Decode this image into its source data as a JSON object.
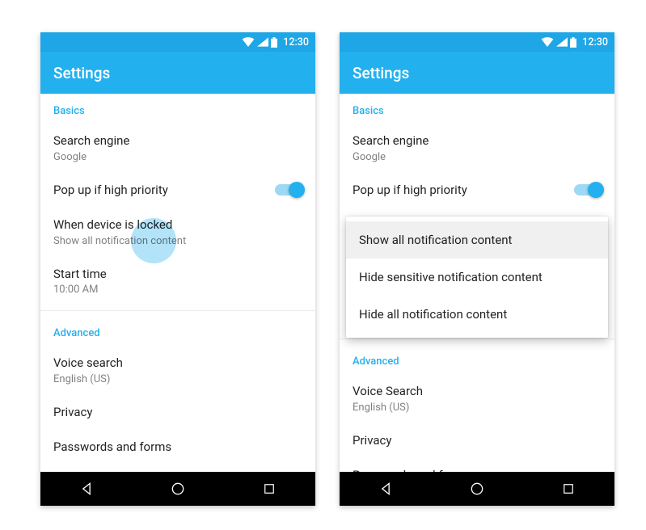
{
  "status": {
    "time": "12:30"
  },
  "appbar": {
    "title": "Settings"
  },
  "sections": {
    "basics": {
      "header": "Basics",
      "searchEngine": {
        "title": "Search engine",
        "value": "Google"
      },
      "popup": {
        "title": "Pop up if high priority"
      },
      "locked": {
        "title": "When device is locked",
        "value": "Show all notification content"
      },
      "startTime": {
        "title": "Start time",
        "value": "10:00 AM"
      }
    },
    "advanced": {
      "header": "Advanced",
      "voiceSearch": {
        "titleA": "Voice search",
        "titleB": "Voice Search",
        "value": "English (US)"
      },
      "privacy": {
        "title": "Privacy"
      },
      "passwordsForms": {
        "title": "Passwords and forms"
      }
    }
  },
  "dropdown": {
    "options": [
      "Show all notification content",
      "Hide sensitive notification content",
      "Hide all notification content"
    ]
  }
}
